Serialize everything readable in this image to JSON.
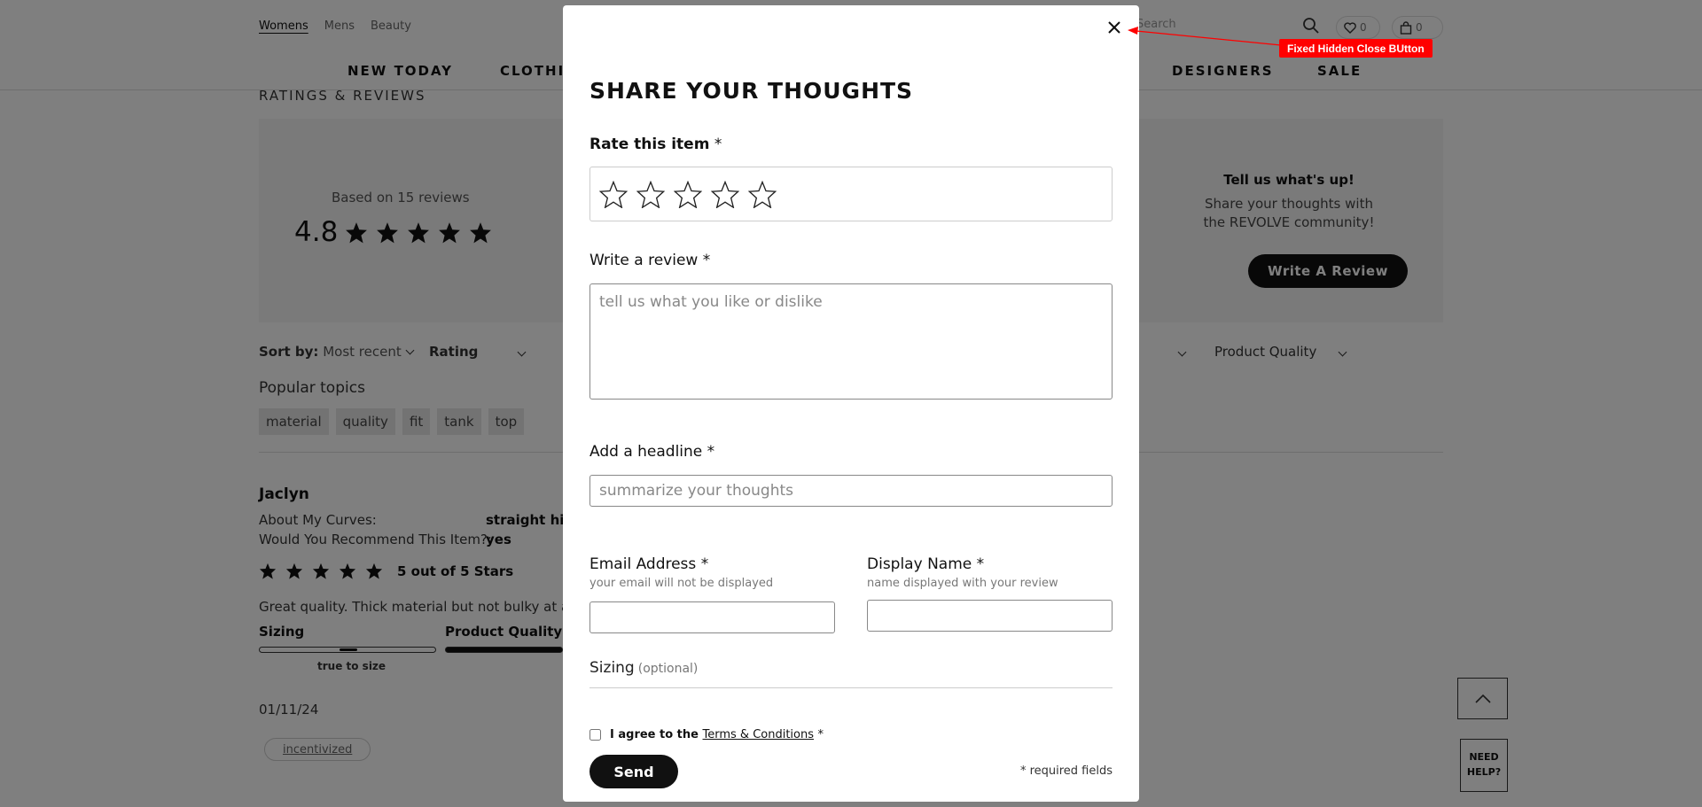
{
  "header": {
    "gender_tabs": [
      "Womens",
      "Mens",
      "Beauty"
    ],
    "search_placeholder": "Search",
    "wishlist_count": "0",
    "bag_count": "0",
    "nav": [
      "NEW TODAY",
      "CLOTHING",
      "DESIGNERS",
      "SALE"
    ]
  },
  "reviews_section": {
    "title": "RATINGS & REVIEWS",
    "based_on": "Based on 15 reviews",
    "average": "4.8",
    "cta_title": "Tell us what's up!",
    "cta_text": "Share your thoughts with the REVOLVE community!",
    "cta_button": "Write A Review",
    "sort_label": "Sort by:",
    "sort_value": "Most recent",
    "filter_rating": "Rating",
    "filter_quality": "Product Quality",
    "popular_label": "Popular topics",
    "topics": [
      "material",
      "quality",
      "fit",
      "tank",
      "top"
    ]
  },
  "review": {
    "author": "Jaclyn",
    "curves_label": "About My Curves:",
    "curves_value": "straight hips",
    "recommend_label": "Would You Recommend This Item?:",
    "recommend_value": "yes",
    "stars_text": "5 out of 5 Stars",
    "text": "Great quality. Thick material but not bulky at all.",
    "sizing_label": "Sizing",
    "sizing_caption": "true to size",
    "quality_label": "Product Quality",
    "date": "01/11/24",
    "badge": "incentivized"
  },
  "help": {
    "need_help": "NEED HELP?"
  },
  "modal": {
    "title": "SHARE YOUR THOUGHTS",
    "rate_label": "Rate this item",
    "review_label": "Write a review",
    "review_placeholder": "tell us what you like or dislike",
    "headline_label": "Add a headline",
    "headline_placeholder": "summarize your thoughts",
    "email_label": "Email Address",
    "email_help": "your email will not be displayed",
    "name_label": "Display Name",
    "name_help": "name displayed with your review",
    "sizing_label": "Sizing",
    "sizing_optional": "(optional)",
    "agree_text": "I agree to the",
    "terms_link": "Terms & Conditions",
    "required_mark": "*",
    "send_button": "Send",
    "required_note": "* required fields"
  },
  "annotation": {
    "text": "Fixed Hidden Close BUtton",
    "color": "#ff0000"
  }
}
